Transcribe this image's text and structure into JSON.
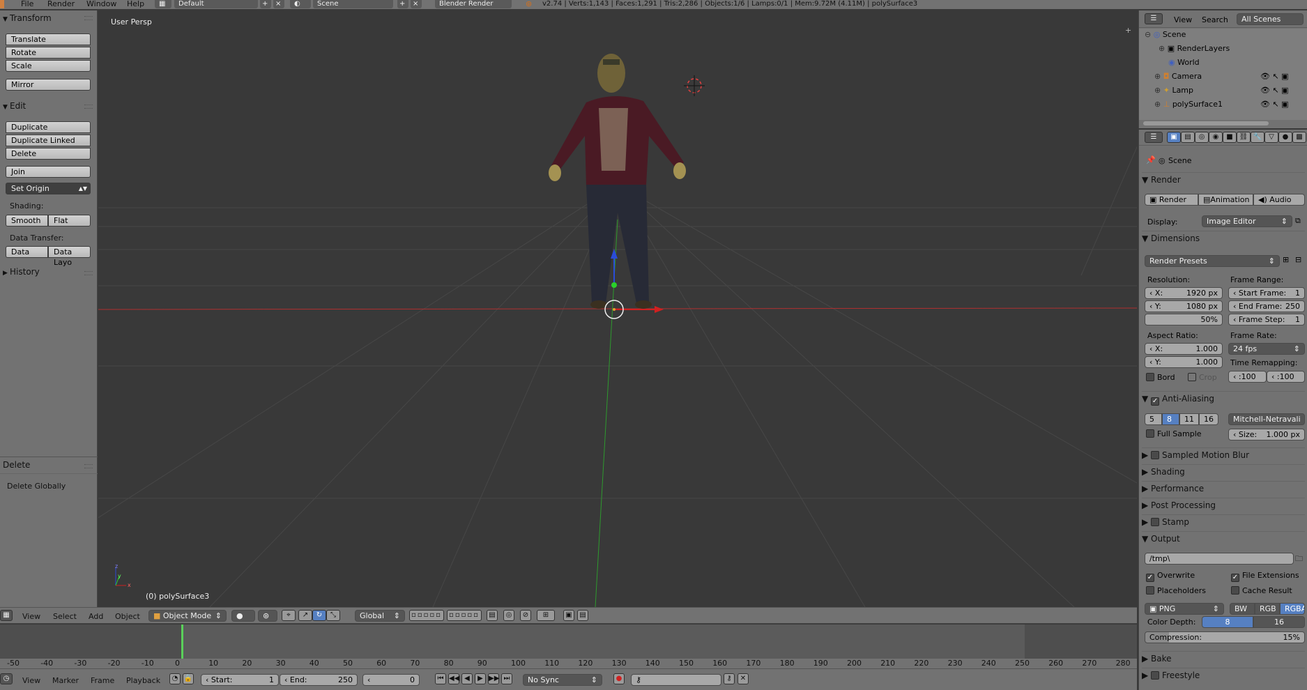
{
  "topbar": {
    "menu": [
      "File",
      "Render",
      "Window",
      "Help"
    ],
    "layout": "Default",
    "scene": "Scene",
    "engine": "Blender Render",
    "stats": "v2.74 | Verts:1,143 | Faces:1,291 | Tris:2,286 | Objects:1/6 | Lamps:0/1 | Mem:9.72M (4.11M) | polySurface3"
  },
  "toolshelf": {
    "transform_title": "Transform",
    "translate": "Translate",
    "rotate": "Rotate",
    "scale": "Scale",
    "mirror": "Mirror",
    "edit_title": "Edit",
    "duplicate": "Duplicate",
    "duplicate_linked": "Duplicate Linked",
    "delete": "Delete",
    "join": "Join",
    "set_origin": "Set Origin",
    "shading_label": "Shading:",
    "smooth": "Smooth",
    "flat": "Flat",
    "data_transfer_label": "Data Transfer:",
    "data": "Data",
    "data_layout": "Data Layo",
    "history_title": "History",
    "operator_title": "Delete",
    "delete_globally": "Delete Globally"
  },
  "viewport": {
    "view_label": "User Persp",
    "object_label": "(0) polySurface3",
    "axis_x": "x",
    "axis_y": "y",
    "axis_z": "z"
  },
  "outliner": {
    "view": "View",
    "search": "Search",
    "filter": "All Scenes",
    "items": [
      "Scene",
      "RenderLayers",
      "World",
      "Camera",
      "Lamp",
      "polySurface1"
    ]
  },
  "properties": {
    "context": "Scene",
    "render_title": "Render",
    "render_btn": "Render",
    "animation_btn": "Animation",
    "audio_btn": "Audio",
    "display_label": "Display:",
    "display_value": "Image Editor",
    "dimensions_title": "Dimensions",
    "render_presets": "Render Presets",
    "resolution_label": "Resolution:",
    "res_x_label": "X:",
    "res_x": "1920 px",
    "res_y_label": "Y:",
    "res_y": "1080 px",
    "res_pct": "50%",
    "frame_range_label": "Frame Range:",
    "start_frame_label": "Start Frame:",
    "start_frame": "1",
    "end_frame_label": "End Frame:",
    "end_frame": "250",
    "frame_step_label": "Frame Step:",
    "frame_step": "1",
    "aspect_label": "Aspect Ratio:",
    "aspect_x_label": "X:",
    "aspect_x": "1.000",
    "aspect_y_label": "Y:",
    "aspect_y": "1.000",
    "frame_rate_label": "Frame Rate:",
    "frame_rate": "24 fps",
    "time_remap_label": "Time Remapping:",
    "remap_old": ":100",
    "remap_new": ":100",
    "bord": "Bord",
    "crop": "Crop",
    "aa_title": "Anti-Aliasing",
    "aa_samples": [
      "5",
      "8",
      "11",
      "16"
    ],
    "aa_filter": "Mitchell-Netravali",
    "full_sample": "Full Sample",
    "size_label": "Size:",
    "size_value": "1.000 px",
    "sections": [
      "Sampled Motion Blur",
      "Shading",
      "Performance",
      "Post Processing",
      "Stamp"
    ],
    "output_title": "Output",
    "output_path": "/tmp\\",
    "overwrite": "Overwrite",
    "file_extensions": "File Extensions",
    "placeholders": "Placeholders",
    "cache_result": "Cache Result",
    "format": "PNG",
    "bw": "BW",
    "rgb": "RGB",
    "rgba": "RGBA",
    "color_depth_label": "Color Depth:",
    "depth_8": "8",
    "depth_16": "16",
    "compression_label": "Compression:",
    "compression_value": "15%",
    "bake_title": "Bake",
    "freestyle_title": "Freestyle"
  },
  "viewport_header": {
    "view": "View",
    "select": "Select",
    "add": "Add",
    "object": "Object",
    "mode": "Object Mode",
    "orientation": "Global"
  },
  "timeline": {
    "ticks": [
      "-50",
      "-40",
      "-30",
      "-20",
      "-10",
      "0",
      "10",
      "20",
      "30",
      "40",
      "50",
      "60",
      "70",
      "80",
      "90",
      "100",
      "110",
      "120",
      "130",
      "140",
      "150",
      "160",
      "170",
      "180",
      "190",
      "200",
      "210",
      "220",
      "230",
      "240",
      "250",
      "260",
      "270",
      "280"
    ],
    "view": "View",
    "marker": "Marker",
    "frame": "Frame",
    "playback": "Playback",
    "start_label": "Start:",
    "start": "1",
    "end_label": "End:",
    "end": "250",
    "current": "0",
    "sync": "No Sync"
  },
  "colors": {
    "panel": "#727272",
    "viewport": "#393939",
    "selected": "#5680c2",
    "x_axis": "#c02020",
    "y_axis": "#20a020",
    "z_axis": "#2040d0"
  }
}
